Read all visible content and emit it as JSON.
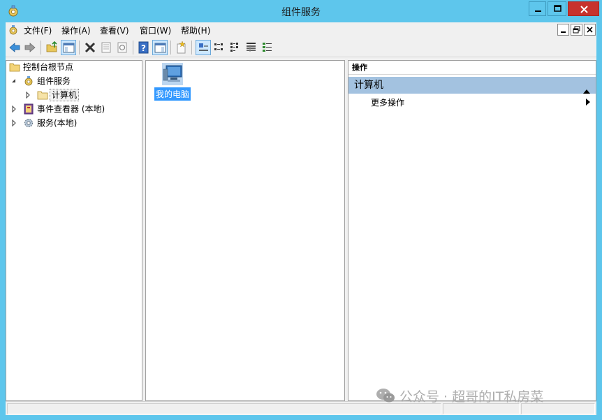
{
  "window": {
    "title": "组件服务"
  },
  "menubar": {
    "items": [
      {
        "id": "file",
        "label": "文件(F)"
      },
      {
        "id": "action",
        "label": "操作(A)"
      },
      {
        "id": "view",
        "label": "查看(V)"
      },
      {
        "id": "window",
        "label": "窗口(W)"
      },
      {
        "id": "help",
        "label": "帮助(H)"
      }
    ]
  },
  "toolbar": {
    "buttons": [
      "back-icon",
      "forward-icon",
      "up-folder-icon",
      "show-hide-console-tree-icon",
      "delete-icon",
      "properties-icon",
      "refresh-icon",
      "help-icon",
      "show-action-pane-icon",
      "new-icon",
      "large-icons-view-icon",
      "small-icons-view-icon",
      "list-view-icon",
      "detail-view-icon",
      "configure-icon"
    ]
  },
  "tree": {
    "root": "控制台根节点",
    "component_services": "组件服务",
    "computers": "计算机",
    "event_viewer": "事件查看器 (本地)",
    "services": "服务(本地)"
  },
  "content": {
    "my_computer": "我的电脑"
  },
  "actions": {
    "header": "操作",
    "section": "计算机",
    "more": "更多操作"
  },
  "watermark": {
    "text": "公众号 · 超哥的IT私房菜"
  },
  "colors": {
    "title_bar": "#5ec6ec",
    "close_button": "#c7322d",
    "selection": "#3399ff",
    "actions_section": "#a3c2e0"
  }
}
